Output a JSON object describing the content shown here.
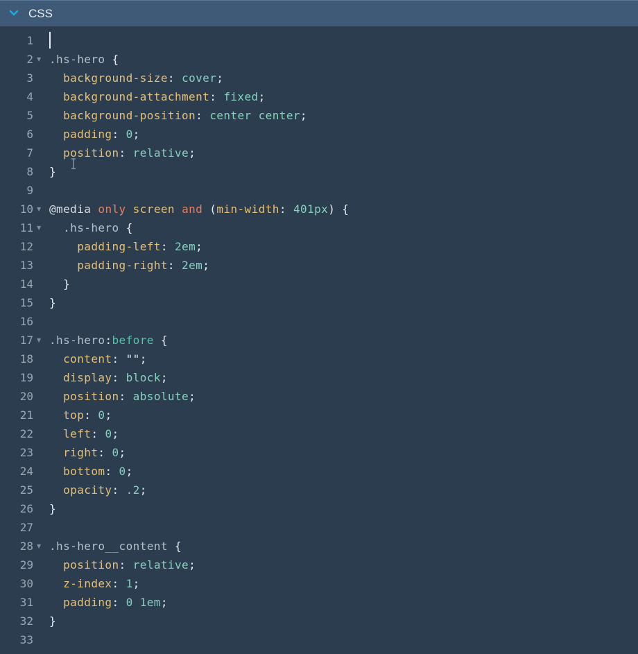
{
  "panel": {
    "title": "CSS",
    "collapse_icon": "chevron-down-icon"
  },
  "colors": {
    "header_bg": "#3f5a76",
    "editor_bg": "#2c3d50",
    "selector": "#b4c0cc",
    "property": "#e6c074",
    "value": "#87d3c0",
    "keyword": "#ef7e58",
    "pseudo": "#4ec9a6"
  },
  "lines": [
    {
      "n": "1",
      "fold": false,
      "tokens": []
    },
    {
      "n": "2",
      "fold": true,
      "tokens": [
        {
          "t": ".hs-hero",
          "c": "sel"
        },
        {
          "t": " {",
          "c": "punc"
        }
      ]
    },
    {
      "n": "3",
      "fold": false,
      "tokens": [
        {
          "t": "  ",
          "c": "plain"
        },
        {
          "t": "background-size",
          "c": "prop"
        },
        {
          "t": ": ",
          "c": "punc"
        },
        {
          "t": "cover",
          "c": "val"
        },
        {
          "t": ";",
          "c": "punc"
        }
      ]
    },
    {
      "n": "4",
      "fold": false,
      "tokens": [
        {
          "t": "  ",
          "c": "plain"
        },
        {
          "t": "background-attachment",
          "c": "prop"
        },
        {
          "t": ": ",
          "c": "punc"
        },
        {
          "t": "fixed",
          "c": "val"
        },
        {
          "t": ";",
          "c": "punc"
        }
      ]
    },
    {
      "n": "5",
      "fold": false,
      "tokens": [
        {
          "t": "  ",
          "c": "plain"
        },
        {
          "t": "background-position",
          "c": "prop"
        },
        {
          "t": ": ",
          "c": "punc"
        },
        {
          "t": "center center",
          "c": "val"
        },
        {
          "t": ";",
          "c": "punc"
        }
      ]
    },
    {
      "n": "6",
      "fold": false,
      "tokens": [
        {
          "t": "  ",
          "c": "plain"
        },
        {
          "t": "padding",
          "c": "prop"
        },
        {
          "t": ": ",
          "c": "punc"
        },
        {
          "t": "0",
          "c": "val"
        },
        {
          "t": ";",
          "c": "punc"
        }
      ]
    },
    {
      "n": "7",
      "fold": false,
      "tokens": [
        {
          "t": "  ",
          "c": "plain"
        },
        {
          "t": "position",
          "c": "prop"
        },
        {
          "t": ": ",
          "c": "punc"
        },
        {
          "t": "relative",
          "c": "val"
        },
        {
          "t": ";",
          "c": "punc"
        }
      ]
    },
    {
      "n": "8",
      "fold": false,
      "tokens": [
        {
          "t": "}",
          "c": "punc"
        }
      ]
    },
    {
      "n": "9",
      "fold": false,
      "tokens": []
    },
    {
      "n": "10",
      "fold": true,
      "tokens": [
        {
          "t": "@media",
          "c": "at"
        },
        {
          "t": " ",
          "c": "plain"
        },
        {
          "t": "only",
          "c": "kw"
        },
        {
          "t": " ",
          "c": "plain"
        },
        {
          "t": "screen",
          "c": "prop"
        },
        {
          "t": " ",
          "c": "plain"
        },
        {
          "t": "and",
          "c": "kw"
        },
        {
          "t": " (",
          "c": "punc"
        },
        {
          "t": "min-width",
          "c": "prop"
        },
        {
          "t": ": ",
          "c": "punc"
        },
        {
          "t": "401px",
          "c": "val"
        },
        {
          "t": ") {",
          "c": "punc"
        }
      ]
    },
    {
      "n": "11",
      "fold": true,
      "tokens": [
        {
          "t": "  ",
          "c": "plain"
        },
        {
          "t": ".hs-hero",
          "c": "sel"
        },
        {
          "t": " {",
          "c": "punc"
        }
      ]
    },
    {
      "n": "12",
      "fold": false,
      "tokens": [
        {
          "t": "    ",
          "c": "plain"
        },
        {
          "t": "padding-left",
          "c": "prop"
        },
        {
          "t": ": ",
          "c": "punc"
        },
        {
          "t": "2em",
          "c": "val"
        },
        {
          "t": ";",
          "c": "punc"
        }
      ]
    },
    {
      "n": "13",
      "fold": false,
      "tokens": [
        {
          "t": "    ",
          "c": "plain"
        },
        {
          "t": "padding-right",
          "c": "prop"
        },
        {
          "t": ": ",
          "c": "punc"
        },
        {
          "t": "2em",
          "c": "val"
        },
        {
          "t": ";",
          "c": "punc"
        }
      ]
    },
    {
      "n": "14",
      "fold": false,
      "tokens": [
        {
          "t": "  ",
          "c": "plain"
        },
        {
          "t": "}",
          "c": "punc"
        }
      ]
    },
    {
      "n": "15",
      "fold": false,
      "tokens": [
        {
          "t": "}",
          "c": "punc"
        }
      ]
    },
    {
      "n": "16",
      "fold": false,
      "tokens": []
    },
    {
      "n": "17",
      "fold": true,
      "tokens": [
        {
          "t": ".hs-hero",
          "c": "sel"
        },
        {
          "t": ":",
          "c": "punc"
        },
        {
          "t": "before",
          "c": "pseudo"
        },
        {
          "t": " {",
          "c": "punc"
        }
      ]
    },
    {
      "n": "18",
      "fold": false,
      "tokens": [
        {
          "t": "  ",
          "c": "plain"
        },
        {
          "t": "content",
          "c": "prop"
        },
        {
          "t": ": ",
          "c": "punc"
        },
        {
          "t": "\"\"",
          "c": "punc"
        },
        {
          "t": ";",
          "c": "punc"
        }
      ]
    },
    {
      "n": "19",
      "fold": false,
      "tokens": [
        {
          "t": "  ",
          "c": "plain"
        },
        {
          "t": "display",
          "c": "prop"
        },
        {
          "t": ": ",
          "c": "punc"
        },
        {
          "t": "block",
          "c": "val"
        },
        {
          "t": ";",
          "c": "punc"
        }
      ]
    },
    {
      "n": "20",
      "fold": false,
      "tokens": [
        {
          "t": "  ",
          "c": "plain"
        },
        {
          "t": "position",
          "c": "prop"
        },
        {
          "t": ": ",
          "c": "punc"
        },
        {
          "t": "absolute",
          "c": "val"
        },
        {
          "t": ";",
          "c": "punc"
        }
      ]
    },
    {
      "n": "21",
      "fold": false,
      "tokens": [
        {
          "t": "  ",
          "c": "plain"
        },
        {
          "t": "top",
          "c": "prop"
        },
        {
          "t": ": ",
          "c": "punc"
        },
        {
          "t": "0",
          "c": "val"
        },
        {
          "t": ";",
          "c": "punc"
        }
      ]
    },
    {
      "n": "22",
      "fold": false,
      "tokens": [
        {
          "t": "  ",
          "c": "plain"
        },
        {
          "t": "left",
          "c": "prop"
        },
        {
          "t": ": ",
          "c": "punc"
        },
        {
          "t": "0",
          "c": "val"
        },
        {
          "t": ";",
          "c": "punc"
        }
      ]
    },
    {
      "n": "23",
      "fold": false,
      "tokens": [
        {
          "t": "  ",
          "c": "plain"
        },
        {
          "t": "right",
          "c": "prop"
        },
        {
          "t": ": ",
          "c": "punc"
        },
        {
          "t": "0",
          "c": "val"
        },
        {
          "t": ";",
          "c": "punc"
        }
      ]
    },
    {
      "n": "24",
      "fold": false,
      "tokens": [
        {
          "t": "  ",
          "c": "plain"
        },
        {
          "t": "bottom",
          "c": "prop"
        },
        {
          "t": ": ",
          "c": "punc"
        },
        {
          "t": "0",
          "c": "val"
        },
        {
          "t": ";",
          "c": "punc"
        }
      ]
    },
    {
      "n": "25",
      "fold": false,
      "tokens": [
        {
          "t": "  ",
          "c": "plain"
        },
        {
          "t": "opacity",
          "c": "prop"
        },
        {
          "t": ": ",
          "c": "punc"
        },
        {
          "t": ".2",
          "c": "val"
        },
        {
          "t": ";",
          "c": "punc"
        }
      ]
    },
    {
      "n": "26",
      "fold": false,
      "tokens": [
        {
          "t": "}",
          "c": "punc"
        }
      ]
    },
    {
      "n": "27",
      "fold": false,
      "tokens": []
    },
    {
      "n": "28",
      "fold": true,
      "tokens": [
        {
          "t": ".hs-hero__content",
          "c": "sel"
        },
        {
          "t": " {",
          "c": "punc"
        }
      ]
    },
    {
      "n": "29",
      "fold": false,
      "tokens": [
        {
          "t": "  ",
          "c": "plain"
        },
        {
          "t": "position",
          "c": "prop"
        },
        {
          "t": ": ",
          "c": "punc"
        },
        {
          "t": "relative",
          "c": "val"
        },
        {
          "t": ";",
          "c": "punc"
        }
      ]
    },
    {
      "n": "30",
      "fold": false,
      "tokens": [
        {
          "t": "  ",
          "c": "plain"
        },
        {
          "t": "z-index",
          "c": "prop"
        },
        {
          "t": ": ",
          "c": "punc"
        },
        {
          "t": "1",
          "c": "val"
        },
        {
          "t": ";",
          "c": "punc"
        }
      ]
    },
    {
      "n": "31",
      "fold": false,
      "tokens": [
        {
          "t": "  ",
          "c": "plain"
        },
        {
          "t": "padding",
          "c": "prop"
        },
        {
          "t": ": ",
          "c": "punc"
        },
        {
          "t": "0 1em",
          "c": "val"
        },
        {
          "t": ";",
          "c": "punc"
        }
      ]
    },
    {
      "n": "32",
      "fold": false,
      "tokens": [
        {
          "t": "}",
          "c": "punc"
        }
      ]
    },
    {
      "n": "33",
      "fold": false,
      "tokens": []
    }
  ]
}
